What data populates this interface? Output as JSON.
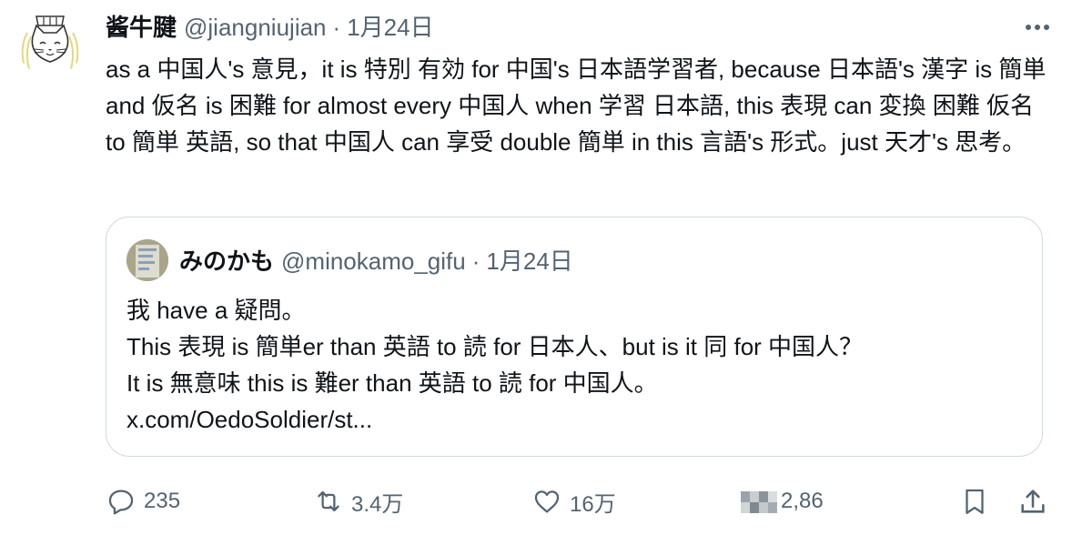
{
  "tweet": {
    "author": {
      "display_name": "酱牛腱",
      "handle": "@jiangniujian",
      "avatar_icon": "cat-chef-avatar-icon"
    },
    "separator": "·",
    "date": "1月24日",
    "body": "as a 中国人's 意見，it is 特別 有効 for 中国's 日本語学習者, because 日本語's 漢字 is 簡単 and 仮名 is 困難 for almost every 中国人 when 学習 日本語, this 表現 can 変換 困難 仮名 to 簡単 英語, so that 中国人 can 享受 double 簡単 in this 言語's 形式。just 天才's 思考。",
    "more_icon": "more-options-icon"
  },
  "quote": {
    "author": {
      "display_name": "みのかも",
      "handle": "@minokamo_gifu",
      "avatar_icon": "photo-avatar-icon"
    },
    "separator": "·",
    "date": "1月24日",
    "lines": [
      "我 have a 疑問。",
      "This 表現 is 簡単er than 英語 to 読 for 日本人、but is it 同 for 中国人？",
      "It is 無意味 this is 難er than 英語 to 読 for 中国人。",
      "x.com/OedoSoldier/st..."
    ]
  },
  "actions": {
    "replies": "235",
    "retweets": "3.4万",
    "likes": "16万",
    "views": "2,86",
    "icons": [
      "reply-icon",
      "retweet-icon",
      "like-icon",
      "views-icon",
      "bookmark-icon",
      "share-icon"
    ]
  },
  "colors": {
    "text_primary": "#0f1419",
    "text_secondary": "#536471",
    "border": "#cfd9de",
    "background": "#ffffff"
  }
}
